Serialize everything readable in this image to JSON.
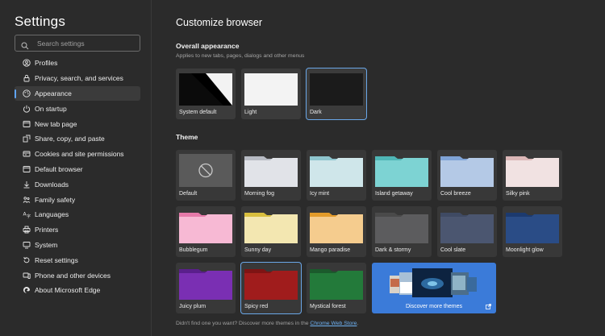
{
  "sidebar": {
    "title": "Settings",
    "search_placeholder": "Search settings",
    "items": [
      {
        "label": "Profiles",
        "icon": "profile-icon"
      },
      {
        "label": "Privacy, search, and services",
        "icon": "lock-icon"
      },
      {
        "label": "Appearance",
        "icon": "palette-icon",
        "active": true
      },
      {
        "label": "On startup",
        "icon": "power-icon"
      },
      {
        "label": "New tab page",
        "icon": "new-tab-icon"
      },
      {
        "label": "Share, copy, and paste",
        "icon": "share-icon"
      },
      {
        "label": "Cookies and site permissions",
        "icon": "cookies-icon"
      },
      {
        "label": "Default browser",
        "icon": "browser-icon"
      },
      {
        "label": "Downloads",
        "icon": "download-icon"
      },
      {
        "label": "Family safety",
        "icon": "family-icon"
      },
      {
        "label": "Languages",
        "icon": "language-icon"
      },
      {
        "label": "Printers",
        "icon": "printer-icon"
      },
      {
        "label": "System",
        "icon": "system-icon"
      },
      {
        "label": "Reset settings",
        "icon": "reset-icon"
      },
      {
        "label": "Phone and other devices",
        "icon": "phone-icon"
      },
      {
        "label": "About Microsoft Edge",
        "icon": "edge-icon"
      }
    ]
  },
  "main": {
    "title": "Customize browser",
    "overall": {
      "title": "Overall appearance",
      "subtitle": "Applies to new tabs, pages, dialogs and other menus",
      "options": [
        {
          "label": "System default"
        },
        {
          "label": "Light"
        },
        {
          "label": "Dark",
          "selected": true
        }
      ]
    },
    "theme": {
      "title": "Theme",
      "tiles": [
        {
          "label": "Default",
          "back": "#5a5a5a",
          "front": "#5a5a5a"
        },
        {
          "label": "Morning fog",
          "back": "#b8bcc4",
          "front": "#e1e3e8"
        },
        {
          "label": "Icy mint",
          "back": "#8fc6cf",
          "front": "#cfe6ea"
        },
        {
          "label": "Island getaway",
          "back": "#4fb6b6",
          "front": "#7dd3d3"
        },
        {
          "label": "Cool breeze",
          "back": "#7fa3d6",
          "front": "#b4c9e6"
        },
        {
          "label": "Silky pink",
          "back": "#dcb8b8",
          "front": "#f1e2e2"
        },
        {
          "label": "Bubblegum",
          "back": "#e67aa9",
          "front": "#f7b9d4"
        },
        {
          "label": "Sunny day",
          "back": "#d8be3e",
          "front": "#f3e7b1"
        },
        {
          "label": "Mango paradise",
          "back": "#e39b2a",
          "front": "#f5cc8e"
        },
        {
          "label": "Dark & stormy",
          "back": "#4a4a4a",
          "front": "#5c5c5e"
        },
        {
          "label": "Cool slate",
          "back": "#3f4a63",
          "front": "#4b5670"
        },
        {
          "label": "Moonlight glow",
          "back": "#1c3a6e",
          "front": "#2a4c86"
        },
        {
          "label": "Juicy plum",
          "back": "#5a1f8c",
          "front": "#7a2fb3"
        },
        {
          "label": "Spicy red",
          "back": "#7e1414",
          "front": "#a01c1c",
          "selected": true
        },
        {
          "label": "Mystical forest",
          "back": "#1b5a2c",
          "front": "#237a3a"
        }
      ]
    },
    "discover_label": "Discover more themes",
    "footer_text": "Didn't find one you want? Discover more themes in the ",
    "footer_link": "Chrome Web Store",
    "footer_end": "."
  }
}
